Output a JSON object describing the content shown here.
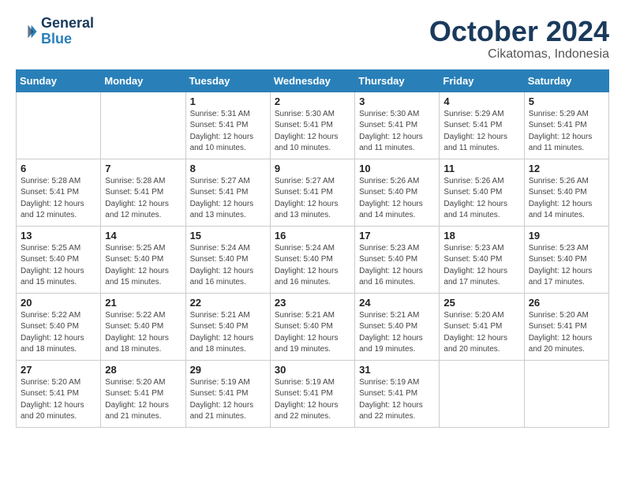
{
  "header": {
    "logo_line1": "General",
    "logo_line2": "Blue",
    "month": "October 2024",
    "location": "Cikatomas, Indonesia"
  },
  "weekdays": [
    "Sunday",
    "Monday",
    "Tuesday",
    "Wednesday",
    "Thursday",
    "Friday",
    "Saturday"
  ],
  "weeks": [
    [
      {
        "day": "",
        "empty": true
      },
      {
        "day": "",
        "empty": true
      },
      {
        "day": "1",
        "sunrise": "Sunrise: 5:31 AM",
        "sunset": "Sunset: 5:41 PM",
        "daylight": "Daylight: 12 hours and 10 minutes."
      },
      {
        "day": "2",
        "sunrise": "Sunrise: 5:30 AM",
        "sunset": "Sunset: 5:41 PM",
        "daylight": "Daylight: 12 hours and 10 minutes."
      },
      {
        "day": "3",
        "sunrise": "Sunrise: 5:30 AM",
        "sunset": "Sunset: 5:41 PM",
        "daylight": "Daylight: 12 hours and 11 minutes."
      },
      {
        "day": "4",
        "sunrise": "Sunrise: 5:29 AM",
        "sunset": "Sunset: 5:41 PM",
        "daylight": "Daylight: 12 hours and 11 minutes."
      },
      {
        "day": "5",
        "sunrise": "Sunrise: 5:29 AM",
        "sunset": "Sunset: 5:41 PM",
        "daylight": "Daylight: 12 hours and 11 minutes."
      }
    ],
    [
      {
        "day": "6",
        "sunrise": "Sunrise: 5:28 AM",
        "sunset": "Sunset: 5:41 PM",
        "daylight": "Daylight: 12 hours and 12 minutes."
      },
      {
        "day": "7",
        "sunrise": "Sunrise: 5:28 AM",
        "sunset": "Sunset: 5:41 PM",
        "daylight": "Daylight: 12 hours and 12 minutes."
      },
      {
        "day": "8",
        "sunrise": "Sunrise: 5:27 AM",
        "sunset": "Sunset: 5:41 PM",
        "daylight": "Daylight: 12 hours and 13 minutes."
      },
      {
        "day": "9",
        "sunrise": "Sunrise: 5:27 AM",
        "sunset": "Sunset: 5:41 PM",
        "daylight": "Daylight: 12 hours and 13 minutes."
      },
      {
        "day": "10",
        "sunrise": "Sunrise: 5:26 AM",
        "sunset": "Sunset: 5:40 PM",
        "daylight": "Daylight: 12 hours and 14 minutes."
      },
      {
        "day": "11",
        "sunrise": "Sunrise: 5:26 AM",
        "sunset": "Sunset: 5:40 PM",
        "daylight": "Daylight: 12 hours and 14 minutes."
      },
      {
        "day": "12",
        "sunrise": "Sunrise: 5:26 AM",
        "sunset": "Sunset: 5:40 PM",
        "daylight": "Daylight: 12 hours and 14 minutes."
      }
    ],
    [
      {
        "day": "13",
        "sunrise": "Sunrise: 5:25 AM",
        "sunset": "Sunset: 5:40 PM",
        "daylight": "Daylight: 12 hours and 15 minutes."
      },
      {
        "day": "14",
        "sunrise": "Sunrise: 5:25 AM",
        "sunset": "Sunset: 5:40 PM",
        "daylight": "Daylight: 12 hours and 15 minutes."
      },
      {
        "day": "15",
        "sunrise": "Sunrise: 5:24 AM",
        "sunset": "Sunset: 5:40 PM",
        "daylight": "Daylight: 12 hours and 16 minutes."
      },
      {
        "day": "16",
        "sunrise": "Sunrise: 5:24 AM",
        "sunset": "Sunset: 5:40 PM",
        "daylight": "Daylight: 12 hours and 16 minutes."
      },
      {
        "day": "17",
        "sunrise": "Sunrise: 5:23 AM",
        "sunset": "Sunset: 5:40 PM",
        "daylight": "Daylight: 12 hours and 16 minutes."
      },
      {
        "day": "18",
        "sunrise": "Sunrise: 5:23 AM",
        "sunset": "Sunset: 5:40 PM",
        "daylight": "Daylight: 12 hours and 17 minutes."
      },
      {
        "day": "19",
        "sunrise": "Sunrise: 5:23 AM",
        "sunset": "Sunset: 5:40 PM",
        "daylight": "Daylight: 12 hours and 17 minutes."
      }
    ],
    [
      {
        "day": "20",
        "sunrise": "Sunrise: 5:22 AM",
        "sunset": "Sunset: 5:40 PM",
        "daylight": "Daylight: 12 hours and 18 minutes."
      },
      {
        "day": "21",
        "sunrise": "Sunrise: 5:22 AM",
        "sunset": "Sunset: 5:40 PM",
        "daylight": "Daylight: 12 hours and 18 minutes."
      },
      {
        "day": "22",
        "sunrise": "Sunrise: 5:21 AM",
        "sunset": "Sunset: 5:40 PM",
        "daylight": "Daylight: 12 hours and 18 minutes."
      },
      {
        "day": "23",
        "sunrise": "Sunrise: 5:21 AM",
        "sunset": "Sunset: 5:40 PM",
        "daylight": "Daylight: 12 hours and 19 minutes."
      },
      {
        "day": "24",
        "sunrise": "Sunrise: 5:21 AM",
        "sunset": "Sunset: 5:40 PM",
        "daylight": "Daylight: 12 hours and 19 minutes."
      },
      {
        "day": "25",
        "sunrise": "Sunrise: 5:20 AM",
        "sunset": "Sunset: 5:41 PM",
        "daylight": "Daylight: 12 hours and 20 minutes."
      },
      {
        "day": "26",
        "sunrise": "Sunrise: 5:20 AM",
        "sunset": "Sunset: 5:41 PM",
        "daylight": "Daylight: 12 hours and 20 minutes."
      }
    ],
    [
      {
        "day": "27",
        "sunrise": "Sunrise: 5:20 AM",
        "sunset": "Sunset: 5:41 PM",
        "daylight": "Daylight: 12 hours and 20 minutes."
      },
      {
        "day": "28",
        "sunrise": "Sunrise: 5:20 AM",
        "sunset": "Sunset: 5:41 PM",
        "daylight": "Daylight: 12 hours and 21 minutes."
      },
      {
        "day": "29",
        "sunrise": "Sunrise: 5:19 AM",
        "sunset": "Sunset: 5:41 PM",
        "daylight": "Daylight: 12 hours and 21 minutes."
      },
      {
        "day": "30",
        "sunrise": "Sunrise: 5:19 AM",
        "sunset": "Sunset: 5:41 PM",
        "daylight": "Daylight: 12 hours and 22 minutes."
      },
      {
        "day": "31",
        "sunrise": "Sunrise: 5:19 AM",
        "sunset": "Sunset: 5:41 PM",
        "daylight": "Daylight: 12 hours and 22 minutes."
      },
      {
        "day": "",
        "empty": true
      },
      {
        "day": "",
        "empty": true
      }
    ]
  ]
}
